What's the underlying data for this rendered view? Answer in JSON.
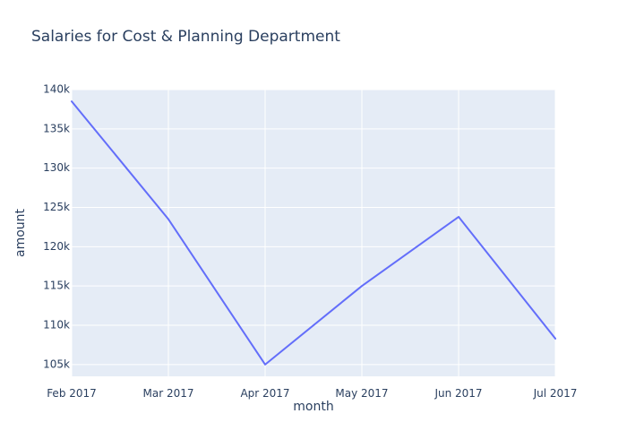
{
  "chart_data": {
    "type": "line",
    "title": "Salaries for Cost & Planning Department",
    "xlabel": "month",
    "ylabel": "amount",
    "x": [
      "Feb 2017",
      "Mar 2017",
      "Apr 2017",
      "May 2017",
      "Jun 2017",
      "Jul 2017"
    ],
    "series": [
      {
        "values": [
          138500,
          123500,
          105000,
          115000,
          123800,
          108300
        ],
        "color": "#636efa"
      }
    ],
    "ylim": [
      103500,
      140000
    ],
    "y_ticks": [
      105000,
      110000,
      115000,
      120000,
      125000,
      130000,
      135000,
      140000
    ],
    "y_tick_labels": [
      "105k",
      "110k",
      "115k",
      "120k",
      "125k",
      "130k",
      "135k",
      "140k"
    ],
    "grid": true,
    "plot_background": "#e5ecf6",
    "grid_color": "#ffffff"
  }
}
